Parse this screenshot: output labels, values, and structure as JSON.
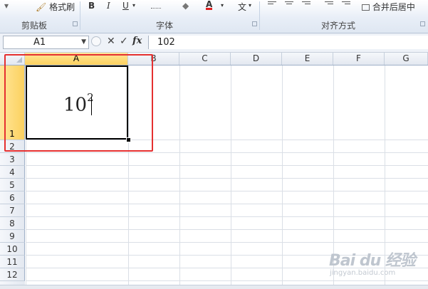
{
  "ribbon": {
    "clipboard": {
      "format_painter": "格式刷",
      "group_label": "剪贴板"
    },
    "font": {
      "bold": "B",
      "italic": "I",
      "underline": "U",
      "font_color": "A",
      "phonetic": "文",
      "group_label": "字体"
    },
    "alignment": {
      "merge_center": "合并后居中",
      "group_label": "对齐方式"
    }
  },
  "formula_bar": {
    "name_box": "A1",
    "cancel_symbol": "✕",
    "enter_symbol": "✓",
    "fx_symbol": "fx",
    "value": "102"
  },
  "columns": [
    "A",
    "B",
    "C",
    "D",
    "E",
    "F",
    "G"
  ],
  "rows": [
    "1",
    "2",
    "3",
    "4",
    "5",
    "6",
    "7",
    "8",
    "9",
    "10",
    "11",
    "12"
  ],
  "selected_cell": "A1",
  "cell_a1": {
    "base": "10",
    "exponent": "2"
  },
  "watermark": {
    "main": "Bai du 经验",
    "url": "jingyan.baidu.com"
  }
}
